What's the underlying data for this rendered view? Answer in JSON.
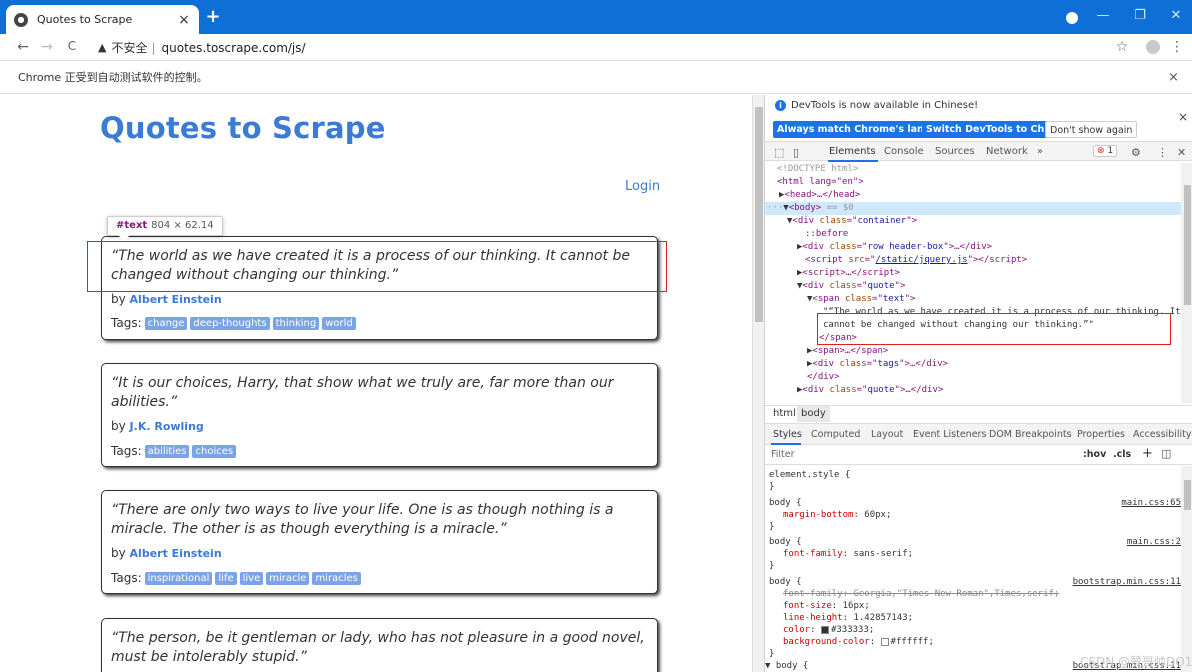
{
  "browser": {
    "tab_title": "Quotes to Scrape",
    "tab_close": "×",
    "new_tab": "+",
    "url_warning": "不安全",
    "url": "quotes.toscrape.com/js/",
    "automation_notice": "Chrome 正受到自动测试软件的控制。",
    "notice_close": "×",
    "back": "←",
    "forward": "→",
    "reload": "C",
    "star": "☆",
    "menu": "⋮",
    "win_min": "—",
    "win_max": "❐",
    "win_close": "✕"
  },
  "page": {
    "title": "Quotes to Scrape",
    "login": "Login",
    "tooltip": {
      "node": "#text",
      "size": "804 × 62.14"
    },
    "by_label": "by",
    "tags_label": "Tags:",
    "quotes": [
      {
        "text": "“The world as we have created it is a process of our thinking. It cannot be changed without changing our thinking.”",
        "author": "Albert Einstein",
        "tags": [
          "change",
          "deep-thoughts",
          "thinking",
          "world"
        ]
      },
      {
        "text": "“It is our choices, Harry, that show what we truly are, far more than our abilities.”",
        "author": "J.K. Rowling",
        "tags": [
          "abilities",
          "choices"
        ]
      },
      {
        "text": "“There are only two ways to live your life. One is as though nothing is a miracle. The other is as though everything is a miracle.”",
        "author": "Albert Einstein",
        "tags": [
          "inspirational",
          "life",
          "live",
          "miracle",
          "miracles"
        ]
      },
      {
        "text": "“The person, be it gentleman or lady, who has not pleasure in a good novel, must be intolerably stupid.”",
        "author": "",
        "tags": []
      }
    ]
  },
  "devtools": {
    "lang_notice": "DevTools is now available in Chinese!",
    "btn_match": "Always match Chrome's language",
    "btn_switch": "Switch DevTools to Chinese",
    "btn_dont": "Don't show again",
    "close": "×",
    "tabs": [
      "Elements",
      "Console",
      "Sources",
      "Network",
      "»"
    ],
    "error_count": "1",
    "breadcrumbs": [
      "html",
      "body"
    ],
    "style_tabs": [
      "Styles",
      "Computed",
      "Layout",
      "Event Listeners",
      "DOM Breakpoints",
      "Properties",
      "Accessibility"
    ],
    "filter_placeholder": "Filter",
    "filter_hov": ":hov",
    "filter_cls": ".cls",
    "filter_plus": "+",
    "dom": {
      "doctype": "<!DOCTYPE html>",
      "html_open": "<html lang=\"en\">",
      "head": "<head>…</head>",
      "body_eq": " == $0",
      "container": "container",
      "before": "::before",
      "header_box": "row header-box",
      "jquery": "/static/jquery.js",
      "quote_cls": "quote",
      "text_cls": "text",
      "text_line1": "\"“The world as we have created it is a process of our thinking. It",
      "text_line2": "cannot be changed without changing our thinking.”\"",
      "tags_cls": "tags"
    },
    "css_rules": {
      "element_style": "element.style {",
      "r1_src": "main.css:65",
      "r1_prop": "margin-bottom",
      "r1_val": "60px",
      "r2_src": "main.css:2",
      "r2_prop": "font-family",
      "r2_val": "sans-serif",
      "r3_src": "bootstrap.min.css:11",
      "r3_ff": "font-family: Georgia,\"Times New Roman\",Times,serif;",
      "r3_fs_prop": "font-size",
      "r3_fs": "16px",
      "r3_lh_prop": "line-height",
      "r3_lh": "1.42857143",
      "r3_color_prop": "color",
      "r3_color": "#333333",
      "r3_bg_prop": "background-color",
      "r3_bg": "#ffffff",
      "r4_src": "bootstrap.min.css:11"
    }
  },
  "watermark": "CSDN @赞哥帅DO1"
}
